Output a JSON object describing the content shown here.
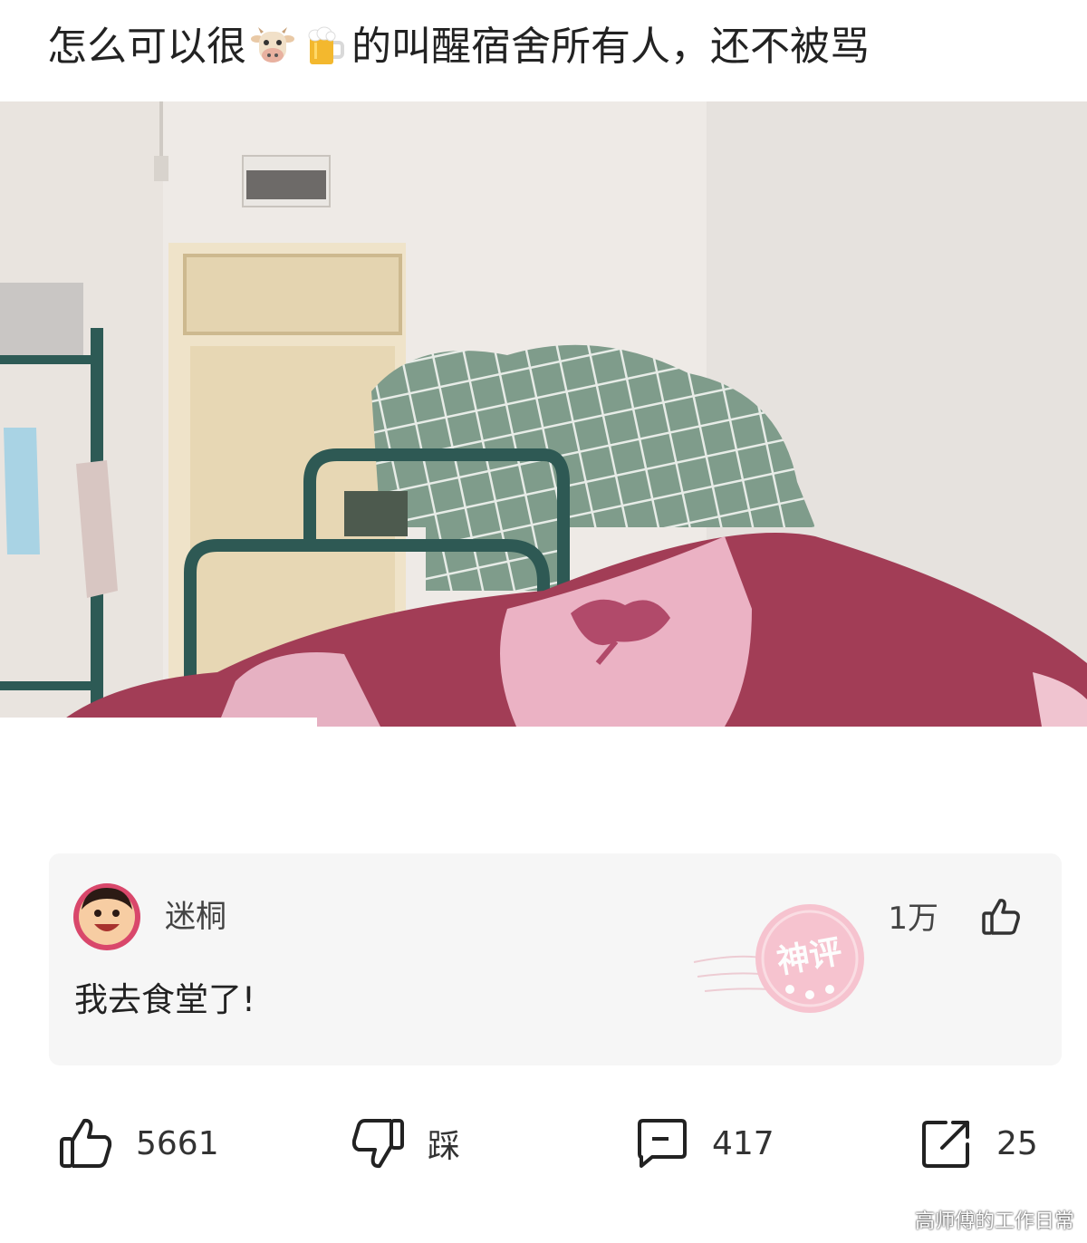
{
  "post": {
    "title_before": "怎么可以很",
    "title_emoji_1": "cow-face-icon",
    "title_emoji_2": "beer-mug-icon",
    "title_after": "的叫醒宿舍所有人，还不被骂"
  },
  "comment": {
    "author": "迷桐",
    "text": "我去食堂了!",
    "likes": "1万",
    "badge": "神评"
  },
  "actions": {
    "like_count": "5661",
    "dislike_label": "踩",
    "comment_count": "417",
    "share_count": "25"
  },
  "watermark": "高师傅的工作日常"
}
